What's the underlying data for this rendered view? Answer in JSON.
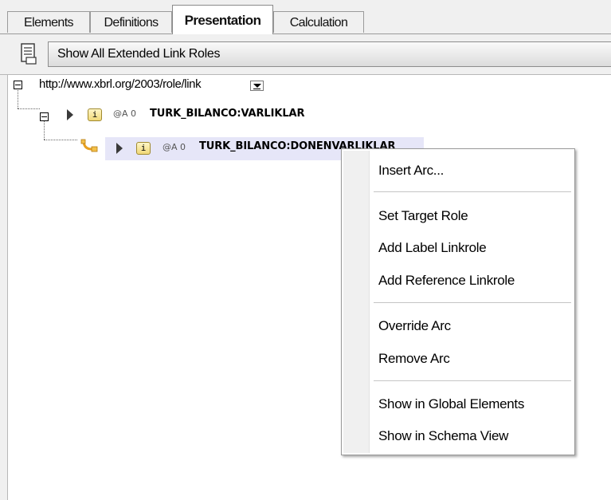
{
  "tabs": [
    {
      "label": "Elements",
      "active": false
    },
    {
      "label": "Definitions",
      "active": false
    },
    {
      "label": "Presentation",
      "active": true
    },
    {
      "label": "Calculation",
      "active": false
    }
  ],
  "toolbar": {
    "roles_button_label": "Show All Extended Link Roles"
  },
  "tree": {
    "root": {
      "role_url": "http://www.xbrl.org/2003/role/link"
    },
    "nodes": [
      {
        "badge": "@A 0",
        "name": "TURK_BILANCO:VARLIKLAR",
        "info": "i"
      },
      {
        "badge": "@A 0",
        "name": "TURK_BILANCO:DONENVARLIKLAR",
        "info": "i",
        "selected": true
      }
    ]
  },
  "context_menu": {
    "items": [
      "Insert Arc...",
      "Set Target Role",
      "Add Label Linkrole",
      "Add Reference Linkrole",
      "Override Arc",
      "Remove Arc",
      "Show in Global Elements",
      "Show in Schema View"
    ]
  },
  "colors": {
    "selection": "#e6e6f8",
    "info_icon": "#f0d878",
    "arc_icon": "#e8a020"
  }
}
